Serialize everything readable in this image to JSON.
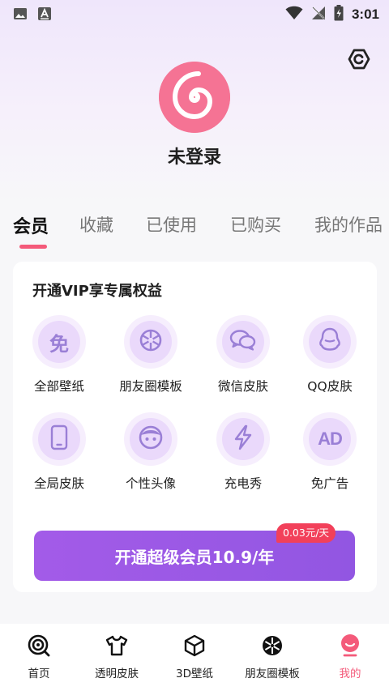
{
  "status_bar": {
    "time": "3:01",
    "icons": [
      "image-notification-icon",
      "a-notification-icon",
      "wifi-icon",
      "no-signal-icon",
      "battery-icon"
    ]
  },
  "header": {
    "settings_icon": "hexagon-settings-icon",
    "avatar_icon": "swirl-avatar-icon",
    "username": "未登录"
  },
  "tabs": [
    {
      "label": "会员",
      "active": true
    },
    {
      "label": "收藏",
      "active": false
    },
    {
      "label": "已使用",
      "active": false
    },
    {
      "label": "已购买",
      "active": false
    },
    {
      "label": "我的作品",
      "active": false
    }
  ],
  "vip_card": {
    "title": "开通VIP享专属权益",
    "perks": [
      {
        "label": "全部壁纸",
        "icon": "free-badge-icon"
      },
      {
        "label": "朋友圈模板",
        "icon": "aperture-icon"
      },
      {
        "label": "微信皮肤",
        "icon": "wechat-icon"
      },
      {
        "label": "QQ皮肤",
        "icon": "qq-penguin-icon"
      },
      {
        "label": "全局皮肤",
        "icon": "phone-icon"
      },
      {
        "label": "个性头像",
        "icon": "face-icon"
      },
      {
        "label": "充电秀",
        "icon": "lightning-icon"
      },
      {
        "label": "免广告",
        "icon": "ad-icon"
      }
    ],
    "perk_icon_text": "免",
    "ad_icon_text": "AD",
    "price_badge": "0.03元/天",
    "button_label": "开通超级会员10.9/年"
  },
  "bottom_nav": [
    {
      "label": "首页",
      "icon": "home-target-icon",
      "active": false
    },
    {
      "label": "透明皮肤",
      "icon": "tshirt-icon",
      "active": false
    },
    {
      "label": "3D壁纸",
      "icon": "cube-icon",
      "active": false
    },
    {
      "label": "朋友圈模板",
      "icon": "aperture-icon",
      "active": false
    },
    {
      "label": "我的",
      "icon": "profile-icon",
      "active": true
    }
  ],
  "colors": {
    "accent_pink": "#f45a7a",
    "vip_purple": "#9b58e5",
    "perk_icon": "#9a7fd6",
    "badge_red": "#f2405a"
  }
}
